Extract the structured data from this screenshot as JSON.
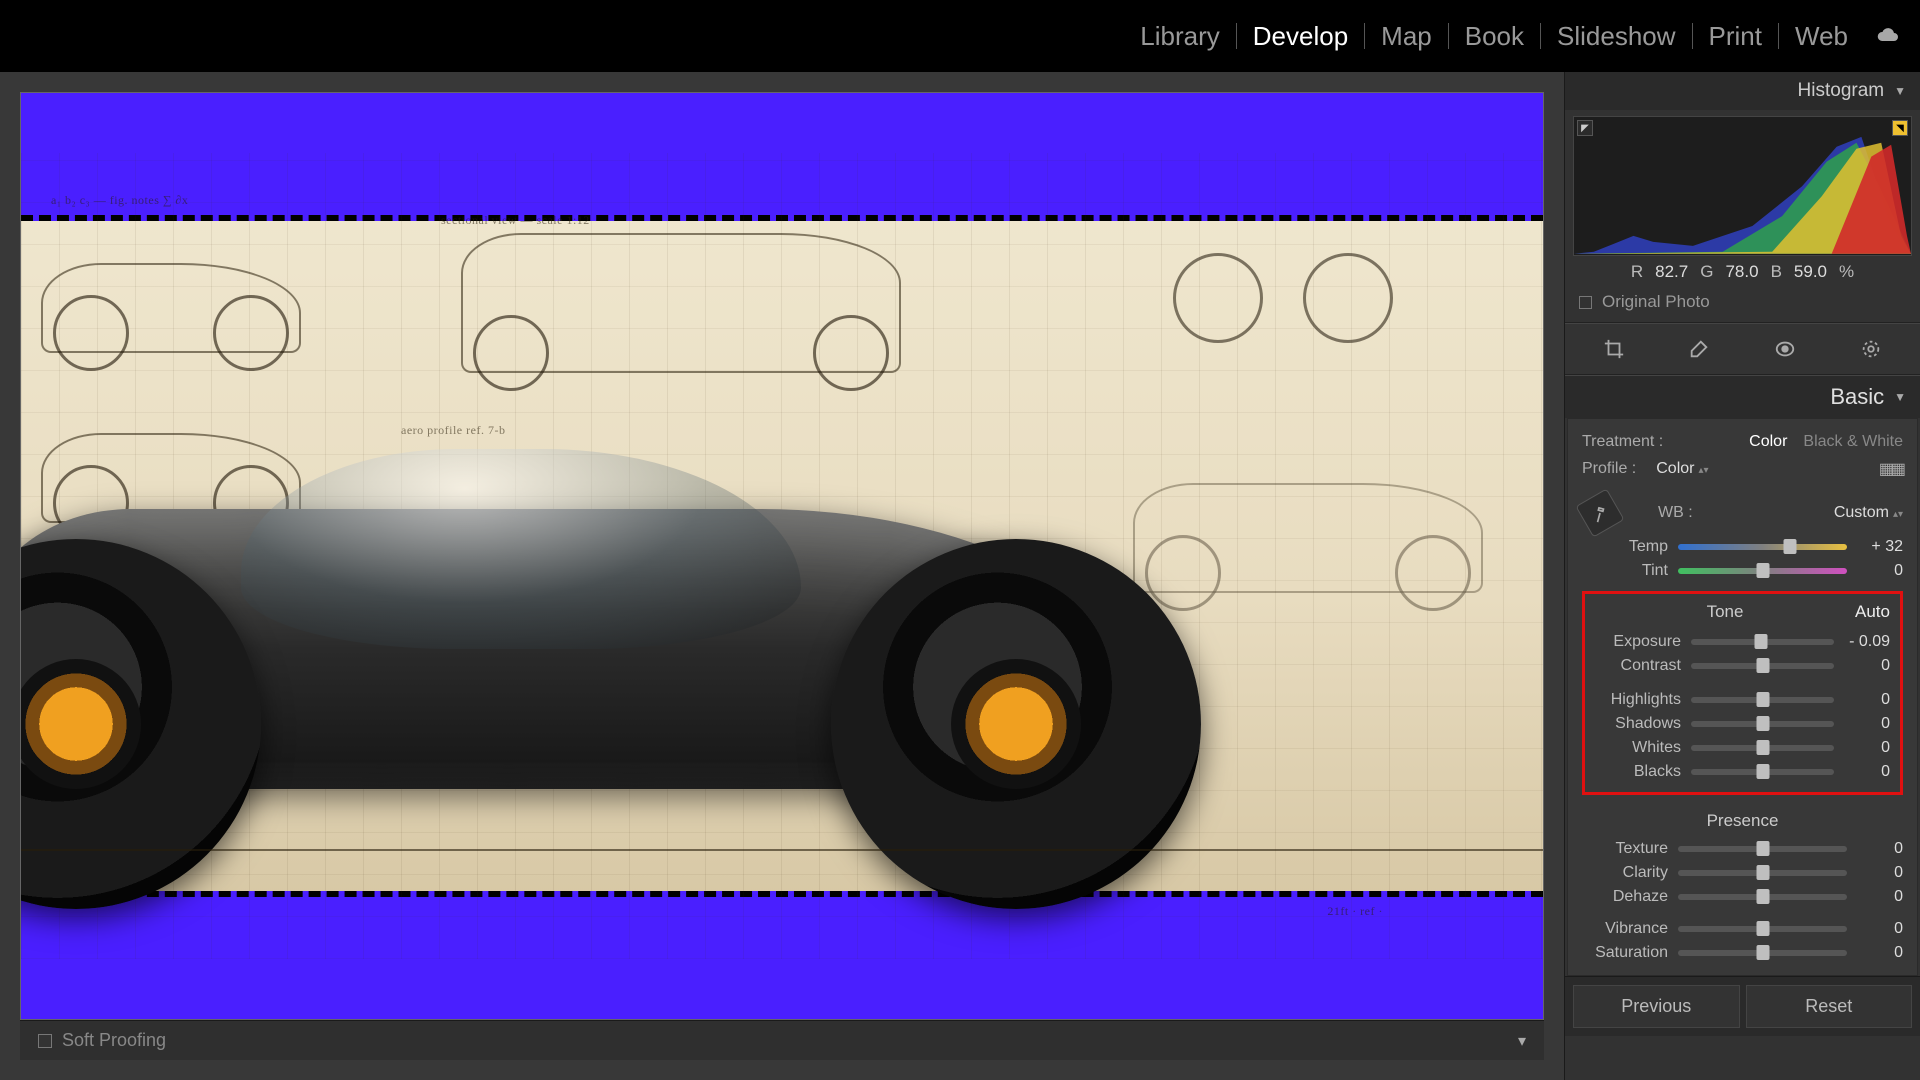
{
  "nav": {
    "items": [
      "Library",
      "Develop",
      "Map",
      "Book",
      "Slideshow",
      "Print",
      "Web"
    ],
    "active": "Develop"
  },
  "bottombar": {
    "soft_proofing": "Soft Proofing"
  },
  "histogram": {
    "title": "Histogram",
    "rgb": {
      "r_label": "R",
      "r": "82.7",
      "g_label": "G",
      "g": "78.0",
      "b_label": "B",
      "b": "59.0",
      "pct": "%"
    },
    "original_label": "Original Photo"
  },
  "basic": {
    "title": "Basic",
    "treatment_label": "Treatment :",
    "treatment_color": "Color",
    "treatment_bw": "Black & White",
    "profile_label": "Profile :",
    "profile_value": "Color",
    "wb_label": "WB :",
    "wb_value": "Custom",
    "temp_label": "Temp",
    "temp_value": "+ 32",
    "tint_label": "Tint",
    "tint_value": "0",
    "tone": {
      "title": "Tone",
      "auto": "Auto",
      "exposure_label": "Exposure",
      "exposure_value": "- 0.09",
      "contrast_label": "Contrast",
      "contrast_value": "0",
      "highlights_label": "Highlights",
      "highlights_value": "0",
      "shadows_label": "Shadows",
      "shadows_value": "0",
      "whites_label": "Whites",
      "whites_value": "0",
      "blacks_label": "Blacks",
      "blacks_value": "0"
    },
    "presence": {
      "title": "Presence",
      "texture_label": "Texture",
      "texture_value": "0",
      "clarity_label": "Clarity",
      "clarity_value": "0",
      "dehaze_label": "Dehaze",
      "dehaze_value": "0",
      "vibrance_label": "Vibrance",
      "vibrance_value": "0",
      "saturation_label": "Saturation",
      "saturation_value": "0"
    }
  },
  "footer": {
    "previous": "Previous",
    "reset": "Reset"
  },
  "sliders": {
    "temp": 66,
    "tint": 50,
    "exposure": 49,
    "contrast": 50,
    "highlights": 50,
    "shadows": 50,
    "whites": 50,
    "blacks": 50,
    "texture": 50,
    "clarity": 50,
    "dehaze": 50,
    "vibrance": 50,
    "saturation": 50
  }
}
